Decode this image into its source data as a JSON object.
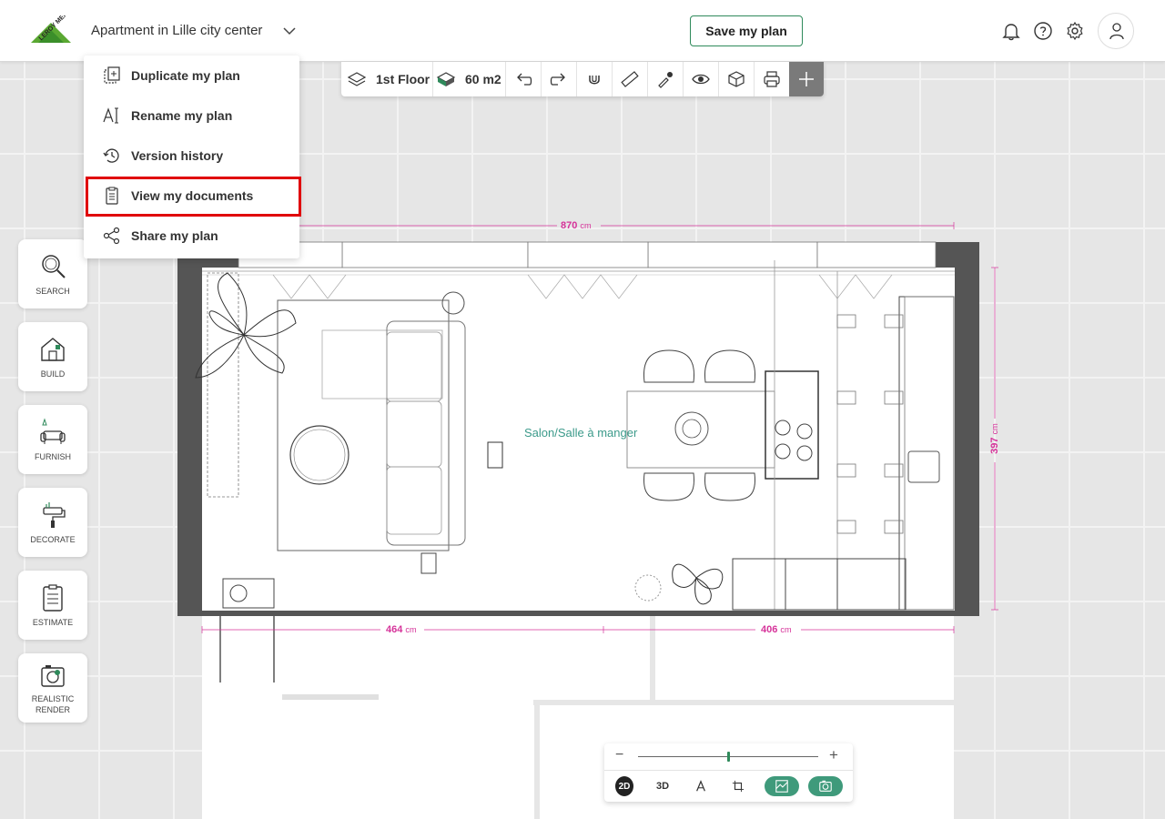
{
  "header": {
    "plan_title": "Apartment in Lille city center",
    "save_label": "Save my plan",
    "logo_text": "LEROY MERLIN",
    "icons": [
      "bell-icon",
      "help-icon",
      "gear-icon",
      "user-icon"
    ]
  },
  "menu": {
    "items": [
      {
        "label": "Duplicate my plan",
        "icon": "duplicate-icon"
      },
      {
        "label": "Rename my plan",
        "icon": "rename-icon"
      },
      {
        "label": "Version history",
        "icon": "history-icon"
      },
      {
        "label": "View my documents",
        "icon": "documents-icon",
        "highlighted": true
      },
      {
        "label": "Share my plan",
        "icon": "share-icon"
      }
    ]
  },
  "toolbar": {
    "floor_label": "1st Floor",
    "area_label": "60 m2",
    "icons": [
      "floor-icon",
      "area-icon",
      "undo-icon",
      "redo-icon",
      "magnet-icon",
      "ruler-icon",
      "eyedropper-icon",
      "eye-icon",
      "cube-icon",
      "print-icon",
      "plus-icon"
    ]
  },
  "sidebar": {
    "items": [
      {
        "label": "SEARCH",
        "icon": "search-icon"
      },
      {
        "label": "BUILD",
        "icon": "house-icon"
      },
      {
        "label": "FURNISH",
        "icon": "sofa-icon"
      },
      {
        "label": "DECORATE",
        "icon": "paint-roller-icon"
      },
      {
        "label": "ESTIMATE",
        "icon": "clipboard-icon"
      },
      {
        "label": "REALISTIC RENDER",
        "icon": "camera-icon"
      }
    ]
  },
  "plan": {
    "room_label": "Salon/Salle à manger",
    "dim_top_value": "870",
    "dim_left_value": "464",
    "dim_right_value": "406",
    "dim_side_value": "397",
    "unit": "cm"
  },
  "zoom": {
    "minus": "−",
    "plus": "+",
    "level": 0.5,
    "btn_2d": "2D",
    "btn_3d": "3D"
  },
  "colors": {
    "brand_green": "#2f8a5b",
    "dimension_pink": "#d6339a",
    "highlight_red": "#e0000a",
    "room_label": "#3b9a8a"
  }
}
